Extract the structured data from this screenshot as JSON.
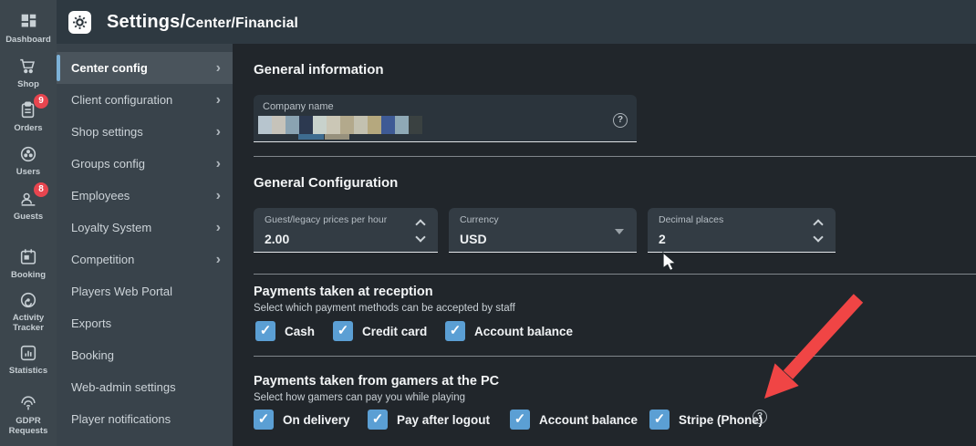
{
  "header": {
    "title_primary": "Settings/",
    "title_secondary": "Center/Financial"
  },
  "rail": {
    "items": [
      {
        "name": "dashboard",
        "label": "Dashboard",
        "badge": ""
      },
      {
        "name": "shop",
        "label": "Shop",
        "badge": ""
      },
      {
        "name": "orders",
        "label": "Orders",
        "badge": "9"
      },
      {
        "name": "users",
        "label": "Users",
        "badge": ""
      },
      {
        "name": "guests",
        "label": "Guests",
        "badge": "8"
      },
      {
        "name": "booking",
        "label": "Booking",
        "badge": ""
      },
      {
        "name": "activity-tracker",
        "label": "Activity Tracker",
        "badge": ""
      },
      {
        "name": "statistics",
        "label": "Statistics",
        "badge": ""
      },
      {
        "name": "gdpr-requests",
        "label": "GDPR Requests",
        "badge": ""
      }
    ]
  },
  "sidebar": {
    "items": [
      {
        "label": "Center config",
        "active": true,
        "chevron": true
      },
      {
        "label": "Client configuration",
        "active": false,
        "chevron": true
      },
      {
        "label": "Shop settings",
        "active": false,
        "chevron": true
      },
      {
        "label": "Groups config",
        "active": false,
        "chevron": true
      },
      {
        "label": "Employees",
        "active": false,
        "chevron": true
      },
      {
        "label": "Loyalty System",
        "active": false,
        "chevron": true
      },
      {
        "label": "Competition",
        "active": false,
        "chevron": true
      },
      {
        "label": "Players Web Portal",
        "active": false,
        "chevron": false
      },
      {
        "label": "Exports",
        "active": false,
        "chevron": false
      },
      {
        "label": "Booking",
        "active": false,
        "chevron": false
      },
      {
        "label": "Web-admin settings",
        "active": false,
        "chevron": false
      },
      {
        "label": "Player notifications",
        "active": false,
        "chevron": false
      }
    ]
  },
  "main": {
    "general_information": {
      "heading": "General information",
      "company_name_label": "Company name",
      "company_name_redacted": true
    },
    "general_configuration": {
      "heading": "General Configuration",
      "fields": [
        {
          "label": "Guest/legacy prices per hour",
          "value": "2.00",
          "control": "stepper"
        },
        {
          "label": "Currency",
          "value": "USD",
          "control": "dropdown"
        },
        {
          "label": "Decimal places",
          "value": "2",
          "control": "stepper"
        }
      ]
    },
    "payments_reception": {
      "heading": "Payments taken at reception",
      "subtitle": "Select which payment methods can be accepted by staff",
      "options": [
        {
          "label": "Cash",
          "checked": true
        },
        {
          "label": "Credit card",
          "checked": true
        },
        {
          "label": "Account balance",
          "checked": true
        }
      ]
    },
    "payments_pc": {
      "heading": "Payments taken from gamers at the PC",
      "subtitle": "Select how gamers can pay you while playing",
      "options": [
        {
          "label": "On delivery",
          "checked": true
        },
        {
          "label": "Pay after logout",
          "checked": true
        },
        {
          "label": "Account balance",
          "checked": true
        },
        {
          "label": "Stripe (Phone)",
          "checked": true
        }
      ]
    }
  },
  "icons": {
    "check": "✓",
    "chevron_right": "›",
    "question": "?"
  },
  "redaction_blocks": [
    "#b7c5ce",
    "#c6c3ba",
    "#8aa3b2",
    "#2c3950",
    "#c8d2cc",
    "#cbc7b6",
    "#b3a98c",
    "#c3c1b0",
    "#b5a87e",
    "#3e5a95",
    "#8fa9b6",
    "#3a4141"
  ],
  "colors": {
    "checkbox_blue": "#5b9fd4",
    "badge_red": "#e8454f",
    "arrow_red": "#f04545",
    "active_indicator": "#7db2d8"
  },
  "annotation": {
    "type": "red-arrow",
    "points_at": "Stripe (Phone) checkbox"
  }
}
